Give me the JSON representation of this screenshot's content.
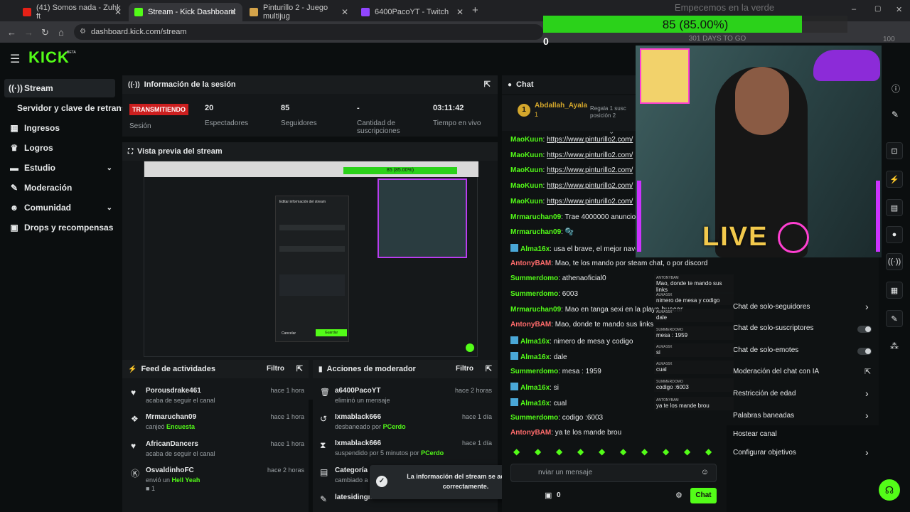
{
  "browser": {
    "tabs": [
      {
        "title": "(41) Somos nada - Zuhk ft",
        "favicon_color": "#e62117"
      },
      {
        "title": "Stream - Kick Dashboard",
        "favicon_color": "#53fc18"
      },
      {
        "title": "Pinturillo 2 - Juego multijug",
        "favicon_color": "#d4a34a"
      },
      {
        "title": "6400PacoYT - Twitch",
        "favicon_color": "#9146ff"
      }
    ],
    "url": "dashboard.kick.com/stream"
  },
  "goal_overlay": {
    "title": "Empecemos en la verde",
    "progress_label": "85 (85.00%)",
    "progress_fraction": 0.85,
    "start_value": "0",
    "end_value": "100",
    "days_label": "301 DAYS TO GO"
  },
  "kick": {
    "logo": "KICK",
    "logo_badge": "BETA",
    "sidebar": [
      {
        "label": "Stream",
        "icon": "broadcast-icon"
      },
      {
        "label": "Servidor y clave de retransm",
        "icon": ""
      },
      {
        "label": "Ingresos",
        "icon": "chart-icon"
      },
      {
        "label": "Logros",
        "icon": "trophy-icon"
      },
      {
        "label": "Estudio",
        "icon": "video-icon"
      },
      {
        "label": "Moderación",
        "icon": "wrench-icon"
      },
      {
        "label": "Comunidad",
        "icon": "people-icon"
      },
      {
        "label": "Drops y recompensas",
        "icon": "gift-icon"
      }
    ],
    "session": {
      "title": "Información de la sesión",
      "status_badge": "TRANSMITIENDO",
      "status_label": "Sesión",
      "stats": [
        {
          "value": "20",
          "label": "Espectadores"
        },
        {
          "value": "85",
          "label": "Seguidores"
        },
        {
          "value": "-",
          "label": "Cantidad de suscripciones"
        },
        {
          "value": "03:11:42",
          "label": "Tiempo en vivo"
        }
      ]
    },
    "preview": {
      "title": "Vista previa del stream",
      "inner_progress": "85 (85.00%)",
      "dialog_title": "Editar información del stream",
      "dialog_cancel": "Cancelar",
      "dialog_save": "Guardar"
    },
    "activity": {
      "title": "Feed de actividades",
      "filter": "Filtro",
      "items": [
        {
          "name": "Porousdrake461",
          "sub": "acaba de seguir el canal",
          "time": "hace 1 hora",
          "icon": "heart-icon"
        },
        {
          "name": "Mrmaruchan09",
          "sub_prefix": "canjeó ",
          "sub_highlight": "Encuesta",
          "time": "hace 1 hora",
          "icon": "redeem-icon"
        },
        {
          "name": "AfricanDancers",
          "sub": "acaba de seguir el canal",
          "time": "hace 1 hora",
          "icon": "heart-icon"
        },
        {
          "name": "OsvaldinhoFC",
          "sub_prefix": "envió un ",
          "sub_highlight": "Hell Yeah",
          "time": "hace 2 horas",
          "icon": "kick-icon",
          "extra": "1"
        }
      ]
    },
    "moderator": {
      "title": "Acciones de moderador",
      "filter": "Filtro",
      "items": [
        {
          "name": "a6400PacoYT",
          "sub": "eliminó un mensaje",
          "time": "hace 2 horas",
          "icon": "trash-icon"
        },
        {
          "name": "Ixmablack666",
          "sub_prefix": "desbaneado por ",
          "sub_highlight": "PCerdo",
          "time": "hace 1 día",
          "icon": "unban-icon"
        },
        {
          "name": "Ixmablack666",
          "sub_prefix": "suspendido por 5 minutos por ",
          "sub_highlight": "PCerdo",
          "time": "hace 1 día",
          "icon": "hourglass-icon"
        },
        {
          "name": "Categoría",
          "sub_prefix": "cambiado a ",
          "sub_highlight": "L",
          "time": "",
          "icon": "category-icon"
        },
        {
          "name": "latesidingm",
          "sub": "",
          "time": "",
          "icon": "edit-icon"
        }
      ]
    },
    "toast": {
      "text": "La información del stream se actualizó correctamente."
    },
    "chat": {
      "title": "Chat",
      "pinned_user": "Abdallah_Ayala",
      "pinned_count": "1",
      "pinned_text": "Regala 1 susc posición 2",
      "messages": [
        {
          "user": "MaoKuun",
          "text": "https://www.pinturillo2.com/",
          "color": "#53fc18",
          "link": true
        },
        {
          "user": "MaoKuun",
          "text": "https://www.pinturillo2.com/",
          "color": "#53fc18",
          "link": true
        },
        {
          "user": "MaoKuun",
          "text": "https://www.pinturillo2.com/",
          "color": "#53fc18",
          "link": true
        },
        {
          "user": "MaoKuun",
          "text": "https://www.pinturillo2.com/",
          "color": "#53fc18",
          "link": true
        },
        {
          "user": "MaoKuun",
          "text": "https://www.pinturillo2.com/",
          "color": "#53fc18",
          "link": true
        },
        {
          "user": "Mrmaruchan09",
          "text": "Trae 4000000 anuncios l",
          "color": "#53fc18"
        },
        {
          "user": "Mrmaruchan09",
          "text": "🫧",
          "color": "#53fc18"
        },
        {
          "user": "Alma16x",
          "text": "usa el brave, el mejor navega",
          "color": "#53fc18",
          "badge": true
        },
        {
          "user": "AntonyBAM",
          "text": "Mao, te los mando por steam chat, o por discord",
          "color": "#ff6b6b"
        },
        {
          "user": "Summerdomo",
          "text": "athenaoficial0",
          "color": "#53fc18"
        },
        {
          "user": "Summerdomo",
          "text": "6003",
          "color": "#53fc18"
        },
        {
          "user": "Mrmaruchan09",
          "text": "Mao en tanga sexi en la playa buscar",
          "color": "#53fc18"
        },
        {
          "user": "AntonyBAM",
          "text": "Mao, donde te mando sus links",
          "color": "#ff6b6b"
        },
        {
          "user": "Alma16x",
          "text": "nimero de mesa y codigo",
          "color": "#53fc18",
          "badge": true
        },
        {
          "user": "Alma16x",
          "text": "dale",
          "color": "#53fc18",
          "badge": true
        },
        {
          "user": "Summerdomo",
          "text": "mesa : 1959",
          "color": "#53fc18"
        },
        {
          "user": "Alma16x",
          "text": "si",
          "color": "#53fc18",
          "badge": true
        },
        {
          "user": "Alma16x",
          "text": "cual",
          "color": "#53fc18",
          "badge": true
        },
        {
          "user": "Summerdomo",
          "text": "codigo :6003",
          "color": "#53fc18"
        },
        {
          "user": "AntonyBAM",
          "text": "ya te los mande brou",
          "color": "#ff6b6b"
        }
      ],
      "input_placeholder": "nviar un mensaje",
      "points": "0",
      "send_label": "Chat"
    },
    "chat_settings": [
      {
        "label": "Chat de solo-seguidores",
        "control": "arrow"
      },
      {
        "label": "Chat de solo-suscriptores",
        "control": "toggle"
      },
      {
        "label": "Chat de solo-emotes",
        "control": "toggle"
      },
      {
        "label": "Moderación del chat con IA",
        "control": "external"
      },
      {
        "label": "Restricción de edad",
        "control": "arrow"
      },
      {
        "label": "Palabras baneadas",
        "control": "arrow"
      },
      {
        "label": "Hostear canal",
        "control": ""
      },
      {
        "label": "Configurar objetivos",
        "control": "arrow"
      }
    ],
    "overlay_chat": [
      {
        "user": "ANTONYBAM",
        "text": "Mao, donde te mando sus links"
      },
      {
        "user": "ALMA16X",
        "text": "nimero de mesa y codigo"
      },
      {
        "user": "ALMA16X",
        "text": "dale"
      },
      {
        "user": "SUMMERDOMO",
        "text": "mesa : 1959"
      },
      {
        "user": "ALMA16X",
        "text": "si"
      },
      {
        "user": "ALMA16X",
        "text": "cual"
      },
      {
        "user": "SUMMERDOMO",
        "text": "codigo :6003"
      },
      {
        "user": "ANTONYBAM",
        "text": "ya te los mande brou"
      }
    ],
    "live_label": "LIVE"
  },
  "colors": {
    "accent": "#53fc18",
    "live_red": "#cc1f1f",
    "overlay_frame": "#cc33ff"
  }
}
